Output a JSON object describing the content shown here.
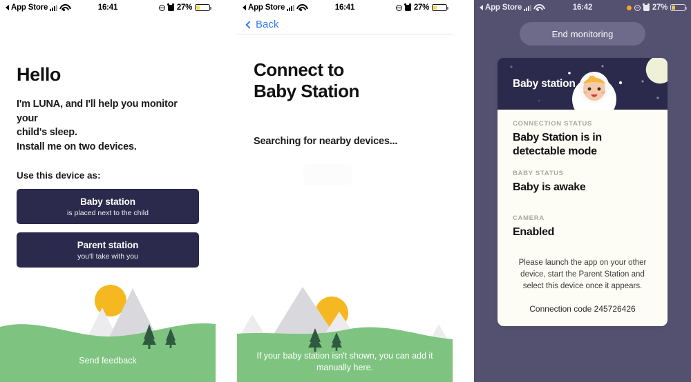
{
  "screens": [
    {
      "id": "welcome",
      "status_bar": {
        "back_app": "App Store",
        "time": "16:41",
        "battery_pct": "27%",
        "icons": [
          "back-triangle-icon",
          "cellular-bars-icon",
          "wifi-icon",
          "location-icon",
          "alarm-icon",
          "battery-icon"
        ]
      },
      "heading": "Hello",
      "intro_lines": [
        "I'm LUNA, and I'll help you monitor your",
        "child's sleep.",
        "Install me on two devices."
      ],
      "prompt": "Use this device as:",
      "options": [
        {
          "title": "Baby station",
          "subtitle": "is placed next to the child"
        },
        {
          "title": "Parent station",
          "subtitle": "you'll take with you"
        }
      ],
      "footer": "Send feedback"
    },
    {
      "id": "connect",
      "status_bar": {
        "back_app": "App Store",
        "time": "16:41",
        "battery_pct": "27%"
      },
      "nav_back": "Back",
      "title_lines": [
        "Connect to",
        "Baby Station"
      ],
      "searching": "Searching for nearby devices...",
      "footer": "If your baby station isn't shown, you can add it manually here."
    },
    {
      "id": "monitoring",
      "status_bar": {
        "back_app": "App Store",
        "time": "16:42",
        "battery_pct": "27%"
      },
      "end_button": "End monitoring",
      "card": {
        "header_title": "Baby station",
        "rows": [
          {
            "label": "CONNECTION STATUS",
            "value": "Baby Station is in detectable mode"
          },
          {
            "label": "BABY STATUS",
            "value": "Baby is awake"
          },
          {
            "label": "CAMERA",
            "value": "Enabled"
          }
        ],
        "hint": "Please launch the app on your other device, start the Parent Station and select this device once it appears.",
        "connection_code": "Connection code 245726426"
      }
    }
  ],
  "colors": {
    "navy": "#2b2a4c",
    "green": "#7ec480",
    "green_light": "#9fd3a0",
    "sun": "#f6b821",
    "mountain": "#d9d9dd",
    "mountain_light": "#ececee",
    "tree": "#2f5a40",
    "purple_bg": "#545070",
    "card_cream": "#fdfdf5",
    "link_blue": "#3478f6",
    "battery_yellow": "#f6d743",
    "rec_orange": "#f5a623"
  }
}
